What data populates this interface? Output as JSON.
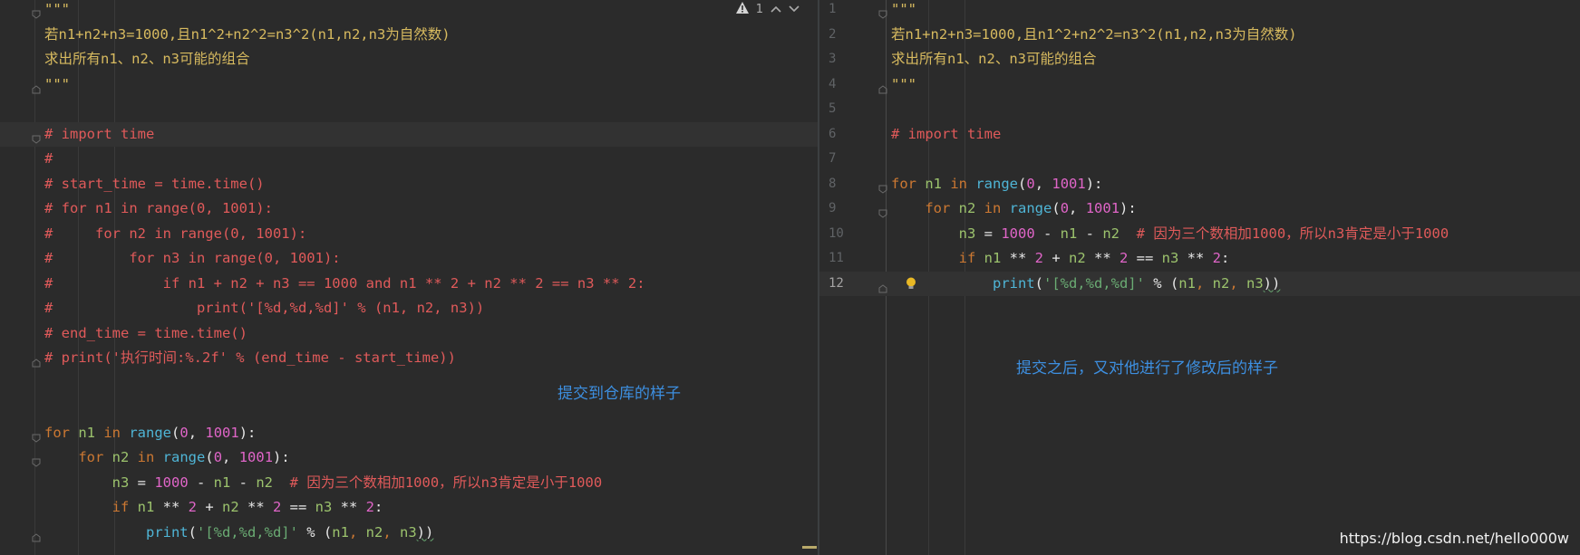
{
  "left_pane": {
    "lines": [
      {
        "tokens": [
          {
            "t": "\"\"\"",
            "c": "doc"
          }
        ]
      },
      {
        "tokens": [
          {
            "t": "若n1+n2+n3=1000,且n1^2+n2^2=n3^2(n1,n2,n3为自然数)",
            "c": "doc"
          }
        ]
      },
      {
        "tokens": [
          {
            "t": "求出所有n1、n2、n3可能的组合",
            "c": "doc"
          }
        ]
      },
      {
        "tokens": [
          {
            "t": "\"\"\"",
            "c": "doc"
          }
        ]
      },
      {
        "tokens": []
      },
      {
        "tokens": [
          {
            "t": "# import time",
            "c": "com"
          }
        ]
      },
      {
        "tokens": [
          {
            "t": "#",
            "c": "com"
          }
        ]
      },
      {
        "tokens": [
          {
            "t": "# start_time = time.time()",
            "c": "com"
          }
        ]
      },
      {
        "tokens": [
          {
            "t": "# for n1 in range(0, 1001):",
            "c": "com"
          }
        ]
      },
      {
        "tokens": [
          {
            "t": "#     for n2 in range(0, 1001):",
            "c": "com"
          }
        ]
      },
      {
        "tokens": [
          {
            "t": "#         for n3 in range(0, 1001):",
            "c": "com"
          }
        ]
      },
      {
        "tokens": [
          {
            "t": "#             if n1 + n2 + n3 == 1000 and n1 ** 2 + n2 ** 2 == n3 ** 2:",
            "c": "com"
          }
        ]
      },
      {
        "tokens": [
          {
            "t": "#                 print('[%d,%d,%d]' % (n1, n2, n3))",
            "c": "com"
          }
        ]
      },
      {
        "tokens": [
          {
            "t": "# end_time = time.time()",
            "c": "com"
          }
        ]
      },
      {
        "tokens": [
          {
            "t": "# print('执行时间:%.2f' % (end_time - start_time))",
            "c": "com"
          }
        ]
      },
      {
        "tokens": []
      },
      {
        "tokens": []
      },
      {
        "tokens": [
          {
            "t": "for",
            "c": "kw"
          },
          {
            "t": " n1 ",
            "c": "id"
          },
          {
            "t": "in",
            "c": "kw"
          },
          {
            "t": " ",
            "c": "op"
          },
          {
            "t": "range",
            "c": "fn"
          },
          {
            "t": "(",
            "c": "op"
          },
          {
            "t": "0",
            "c": "num"
          },
          {
            "t": ", ",
            "c": "op"
          },
          {
            "t": "1001",
            "c": "num"
          },
          {
            "t": "):",
            "c": "op"
          }
        ]
      },
      {
        "tokens": [
          {
            "t": "    for",
            "c": "kw"
          },
          {
            "t": " n2 ",
            "c": "id"
          },
          {
            "t": "in",
            "c": "kw"
          },
          {
            "t": " ",
            "c": "op"
          },
          {
            "t": "range",
            "c": "fn"
          },
          {
            "t": "(",
            "c": "op"
          },
          {
            "t": "0",
            "c": "num"
          },
          {
            "t": ", ",
            "c": "op"
          },
          {
            "t": "1001",
            "c": "num"
          },
          {
            "t": "):",
            "c": "op"
          }
        ]
      },
      {
        "tokens": [
          {
            "t": "        n3",
            "c": "id"
          },
          {
            "t": " = ",
            "c": "op"
          },
          {
            "t": "1000",
            "c": "num"
          },
          {
            "t": " - ",
            "c": "op"
          },
          {
            "t": "n1",
            "c": "id"
          },
          {
            "t": " - ",
            "c": "op"
          },
          {
            "t": "n2",
            "c": "id"
          },
          {
            "t": "  # 因为三个数相加1000，所以n3肯定是小于1000",
            "c": "com"
          }
        ]
      },
      {
        "tokens": [
          {
            "t": "        if",
            "c": "kw"
          },
          {
            "t": " n1 ",
            "c": "id"
          },
          {
            "t": "** ",
            "c": "op"
          },
          {
            "t": "2",
            "c": "num"
          },
          {
            "t": " + ",
            "c": "op"
          },
          {
            "t": "n2 ",
            "c": "id"
          },
          {
            "t": "** ",
            "c": "op"
          },
          {
            "t": "2",
            "c": "num"
          },
          {
            "t": " == ",
            "c": "op"
          },
          {
            "t": "n3 ",
            "c": "id"
          },
          {
            "t": "** ",
            "c": "op"
          },
          {
            "t": "2",
            "c": "num"
          },
          {
            "t": ":",
            "c": "op"
          }
        ]
      },
      {
        "tokens": [
          {
            "t": "            print",
            "c": "fn"
          },
          {
            "t": "(",
            "c": "op"
          },
          {
            "t": "'[%d,%d,%d]'",
            "c": "str"
          },
          {
            "t": " % (",
            "c": "op"
          },
          {
            "t": "n1",
            "c": "id"
          },
          {
            "t": ", ",
            "c": "kw"
          },
          {
            "t": "n2",
            "c": "id"
          },
          {
            "t": ", ",
            "c": "kw"
          },
          {
            "t": "n3",
            "c": "id"
          },
          {
            "t": "))",
            "c": "op"
          }
        ]
      }
    ],
    "annotation": "提交到仓库的样子",
    "warning_count": "1"
  },
  "right_pane": {
    "lines": [
      {
        "n": "1",
        "tokens": [
          {
            "t": "\"\"\"",
            "c": "doc"
          }
        ]
      },
      {
        "n": "2",
        "tokens": [
          {
            "t": "若n1+n2+n3=1000,且n1^2+n2^2=n3^2(n1,n2,n3为自然数)",
            "c": "doc"
          }
        ]
      },
      {
        "n": "3",
        "tokens": [
          {
            "t": "求出所有n1、n2、n3可能的组合",
            "c": "doc"
          }
        ]
      },
      {
        "n": "4",
        "tokens": [
          {
            "t": "\"\"\"",
            "c": "doc"
          }
        ]
      },
      {
        "n": "5",
        "tokens": []
      },
      {
        "n": "6",
        "tokens": [
          {
            "t": "# import time",
            "c": "com"
          }
        ]
      },
      {
        "n": "7",
        "tokens": []
      },
      {
        "n": "8",
        "tokens": [
          {
            "t": "for",
            "c": "kw"
          },
          {
            "t": " n1 ",
            "c": "id"
          },
          {
            "t": "in",
            "c": "kw"
          },
          {
            "t": " ",
            "c": "op"
          },
          {
            "t": "range",
            "c": "fn"
          },
          {
            "t": "(",
            "c": "op"
          },
          {
            "t": "0",
            "c": "num"
          },
          {
            "t": ", ",
            "c": "op"
          },
          {
            "t": "1001",
            "c": "num"
          },
          {
            "t": "):",
            "c": "op"
          }
        ]
      },
      {
        "n": "9",
        "tokens": [
          {
            "t": "    for",
            "c": "kw"
          },
          {
            "t": " n2 ",
            "c": "id"
          },
          {
            "t": "in",
            "c": "kw"
          },
          {
            "t": " ",
            "c": "op"
          },
          {
            "t": "range",
            "c": "fn"
          },
          {
            "t": "(",
            "c": "op"
          },
          {
            "t": "0",
            "c": "num"
          },
          {
            "t": ", ",
            "c": "op"
          },
          {
            "t": "1001",
            "c": "num"
          },
          {
            "t": "):",
            "c": "op"
          }
        ]
      },
      {
        "n": "10",
        "tokens": [
          {
            "t": "        n3",
            "c": "id"
          },
          {
            "t": " = ",
            "c": "op"
          },
          {
            "t": "1000",
            "c": "num"
          },
          {
            "t": " - ",
            "c": "op"
          },
          {
            "t": "n1",
            "c": "id"
          },
          {
            "t": " - ",
            "c": "op"
          },
          {
            "t": "n2",
            "c": "id"
          },
          {
            "t": "  # 因为三个数相加1000，所以n3肯定是小于1000",
            "c": "com"
          }
        ]
      },
      {
        "n": "11",
        "tokens": [
          {
            "t": "        if",
            "c": "kw"
          },
          {
            "t": " n1 ",
            "c": "id"
          },
          {
            "t": "** ",
            "c": "op"
          },
          {
            "t": "2",
            "c": "num"
          },
          {
            "t": " + ",
            "c": "op"
          },
          {
            "t": "n2 ",
            "c": "id"
          },
          {
            "t": "** ",
            "c": "op"
          },
          {
            "t": "2",
            "c": "num"
          },
          {
            "t": " == ",
            "c": "op"
          },
          {
            "t": "n3 ",
            "c": "id"
          },
          {
            "t": "** ",
            "c": "op"
          },
          {
            "t": "2",
            "c": "num"
          },
          {
            "t": ":",
            "c": "op"
          }
        ]
      },
      {
        "n": "12",
        "tokens": [
          {
            "t": "            print",
            "c": "fn"
          },
          {
            "t": "(",
            "c": "op"
          },
          {
            "t": "'[%d,%d,%d]'",
            "c": "str"
          },
          {
            "t": " % (",
            "c": "op"
          },
          {
            "t": "n1",
            "c": "id"
          },
          {
            "t": ", ",
            "c": "kw"
          },
          {
            "t": "n2",
            "c": "id"
          },
          {
            "t": ", ",
            "c": "kw"
          },
          {
            "t": "n3",
            "c": "id"
          },
          {
            "t": "))",
            "c": "op"
          }
        ]
      }
    ],
    "annotation": "提交之后，又对他进行了修改后的样子"
  },
  "watermark": "https://blog.csdn.net/hello000w",
  "icons": {
    "warning": "warning-icon",
    "up": "chevron-up-icon",
    "down": "chevron-down-icon",
    "bulb": "lightbulb-icon",
    "fold": "fold-marker-icon"
  },
  "colors": {
    "background": "#2b2b2b",
    "docstring": "#d7ba5f",
    "comment": "#e05a5a",
    "keyword": "#cc7832",
    "number": "#e065c8",
    "string": "#6aab73",
    "annotation": "#3d8fe0"
  }
}
